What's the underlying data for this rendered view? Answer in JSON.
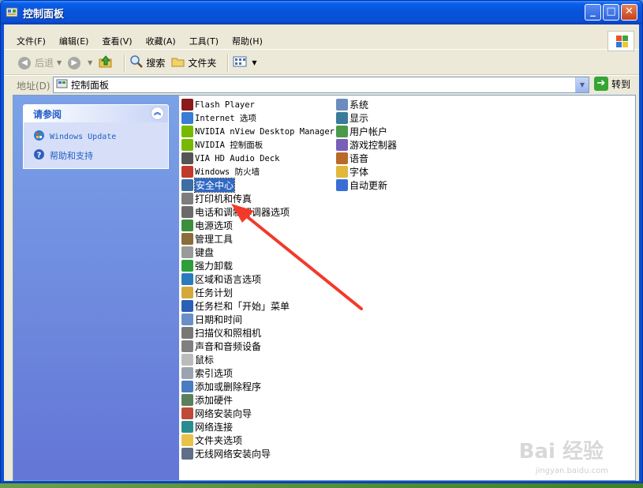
{
  "window": {
    "title": "控制面板"
  },
  "title_buttons": {
    "minimize": "_",
    "maximize": "□",
    "close": "✕"
  },
  "menu": [
    "文件(F)",
    "编辑(E)",
    "查看(V)",
    "收藏(A)",
    "工具(T)",
    "帮助(H)"
  ],
  "toolbar": {
    "back": "后退",
    "search": "搜索",
    "folders": "文件夹"
  },
  "address": {
    "label": "地址(D)",
    "value": "控制面板",
    "go": "转到"
  },
  "sidebar": {
    "header": "请参阅",
    "links": [
      {
        "label": "Windows Update",
        "icon": "windows-update-icon"
      },
      {
        "label": "帮助和支持",
        "icon": "help-icon"
      }
    ]
  },
  "items_col1": [
    {
      "label": "Flash Player",
      "icon": "flash-player-icon",
      "color": "#8b1a1a",
      "mono": true
    },
    {
      "label": "Internet 选项",
      "icon": "internet-options-icon",
      "color": "#3a7bd5",
      "mono": true
    },
    {
      "label": "NVIDIA nView Desktop Manager",
      "icon": "nvidia-nview-icon",
      "color": "#76b900",
      "mono": true
    },
    {
      "label": "NVIDIA 控制面板",
      "icon": "nvidia-control-icon",
      "color": "#76b900",
      "mono": true
    },
    {
      "label": "VIA HD Audio Deck",
      "icon": "via-audio-icon",
      "color": "#555555",
      "mono": true
    },
    {
      "label": "Windows 防火墙",
      "icon": "firewall-icon",
      "color": "#c0392b",
      "mono": true
    },
    {
      "label": "安全中心",
      "icon": "security-center-icon",
      "color": "#3a6ea5",
      "mono": false,
      "selected": true
    },
    {
      "label": "打印机和传真",
      "icon": "printer-icon",
      "color": "#7d7d7d",
      "mono": false
    },
    {
      "label": "电话和调制解调器选项",
      "icon": "phone-modem-icon",
      "color": "#6b6b6b",
      "mono": false
    },
    {
      "label": "电源选项",
      "icon": "power-options-icon",
      "color": "#3b8e3b",
      "mono": false
    },
    {
      "label": "管理工具",
      "icon": "admin-tools-icon",
      "color": "#8a6d3b",
      "mono": false
    },
    {
      "label": "键盘",
      "icon": "keyboard-icon",
      "color": "#9a9a9a",
      "mono": false
    },
    {
      "label": "强力卸载",
      "icon": "uninstall-icon",
      "color": "#2e9e3a",
      "mono": false
    },
    {
      "label": "区域和语言选项",
      "icon": "region-language-icon",
      "color": "#2a7bbd",
      "mono": false
    },
    {
      "label": "任务计划",
      "icon": "scheduled-tasks-icon",
      "color": "#d4a93c",
      "mono": false
    },
    {
      "label": "任务栏和「开始」菜单",
      "icon": "taskbar-icon",
      "color": "#2b5fb8",
      "mono": false
    },
    {
      "label": "日期和时间",
      "icon": "date-time-icon",
      "color": "#6a8fc7",
      "mono": false
    },
    {
      "label": "扫描仪和照相机",
      "icon": "scanner-icon",
      "color": "#777777",
      "mono": false
    },
    {
      "label": "声音和音频设备",
      "icon": "sound-icon",
      "color": "#808080",
      "mono": false
    },
    {
      "label": "鼠标",
      "icon": "mouse-icon",
      "color": "#bbbbbb",
      "mono": false
    },
    {
      "label": "索引选项",
      "icon": "index-options-icon",
      "color": "#9aa4b0",
      "mono": false
    },
    {
      "label": "添加或删除程序",
      "icon": "add-remove-programs-icon",
      "color": "#4a7cc0",
      "mono": false
    },
    {
      "label": "添加硬件",
      "icon": "add-hardware-icon",
      "color": "#5b7f5b",
      "mono": false
    },
    {
      "label": "网络安装向导",
      "icon": "network-setup-icon",
      "color": "#c04a3a",
      "mono": false
    },
    {
      "label": "网络连接",
      "icon": "network-connections-icon",
      "color": "#2a8c8c",
      "mono": false
    },
    {
      "label": "文件夹选项",
      "icon": "folder-options-icon",
      "color": "#e8c34a",
      "mono": false
    },
    {
      "label": "无线网络安装向导",
      "icon": "wireless-setup-icon",
      "color": "#5f6f88",
      "mono": false
    }
  ],
  "items_col2": [
    {
      "label": "系统",
      "icon": "system-icon",
      "color": "#6c8cbf"
    },
    {
      "label": "显示",
      "icon": "display-icon",
      "color": "#3a7a9a"
    },
    {
      "label": "用户帐户",
      "icon": "user-accounts-icon",
      "color": "#4a9a4a"
    },
    {
      "label": "游戏控制器",
      "icon": "game-controller-icon",
      "color": "#7a5fb8"
    },
    {
      "label": "语音",
      "icon": "speech-icon",
      "color": "#b86a2a"
    },
    {
      "label": "字体",
      "icon": "fonts-icon",
      "color": "#e0b83a"
    },
    {
      "label": "自动更新",
      "icon": "automatic-updates-icon",
      "color": "#3a6ed5"
    }
  ],
  "watermark": {
    "main": "Bai 经验",
    "sub": "jingyan.baidu.com"
  }
}
